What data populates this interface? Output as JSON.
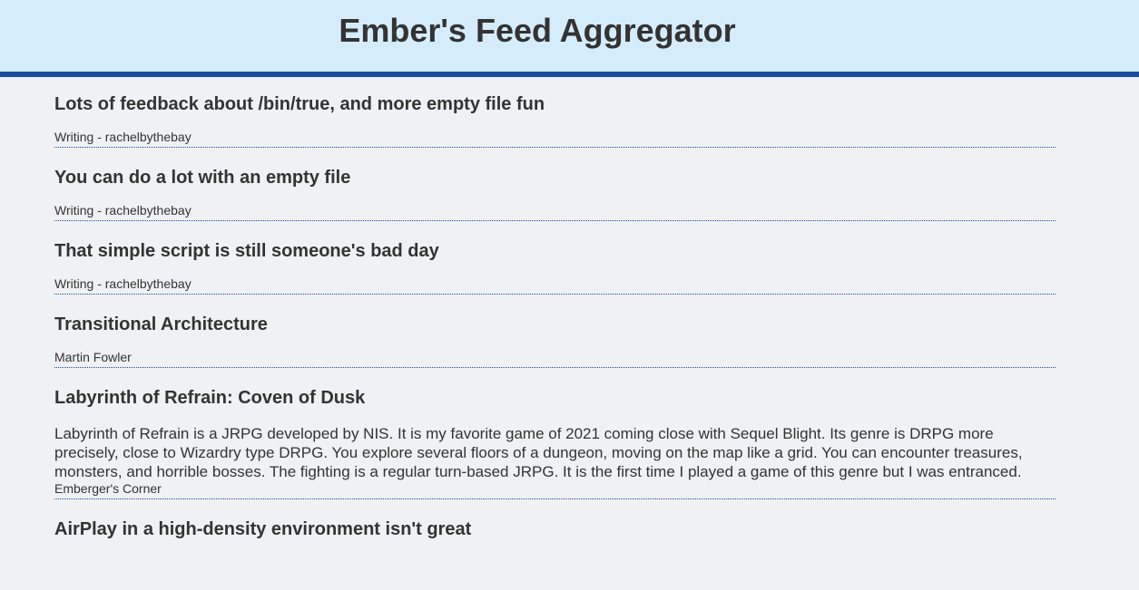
{
  "header": {
    "title": "Ember's Feed Aggregator"
  },
  "entries": [
    {
      "title": "Lots of feedback about /bin/true, and more empty file fun",
      "summary": "",
      "source": "Writing - rachelbythebay"
    },
    {
      "title": "You can do a lot with an empty file",
      "summary": "",
      "source": "Writing - rachelbythebay"
    },
    {
      "title": "That simple script is still someone's bad day",
      "summary": "",
      "source": "Writing - rachelbythebay"
    },
    {
      "title": "Transitional Architecture",
      "summary": "",
      "source": "Martin Fowler"
    },
    {
      "title": "Labyrinth of Refrain: Coven of Dusk",
      "summary": "Labyrinth of Refrain is a JRPG developed by NIS. It is my favorite game of 2021 coming close with Sequel Blight. Its genre is DRPG more precisely, close to Wizardry type DRPG. You explore several floors of a dungeon, moving on the map like a grid. You can encounter treasures, monsters, and horrible bosses. The fighting is a regular turn-based JRPG. It is the first time I played a game of this genre but I was entranced.",
      "source": "Emberger's Corner"
    },
    {
      "title": "AirPlay in a high-density environment isn't great",
      "summary": "",
      "source": ""
    }
  ]
}
